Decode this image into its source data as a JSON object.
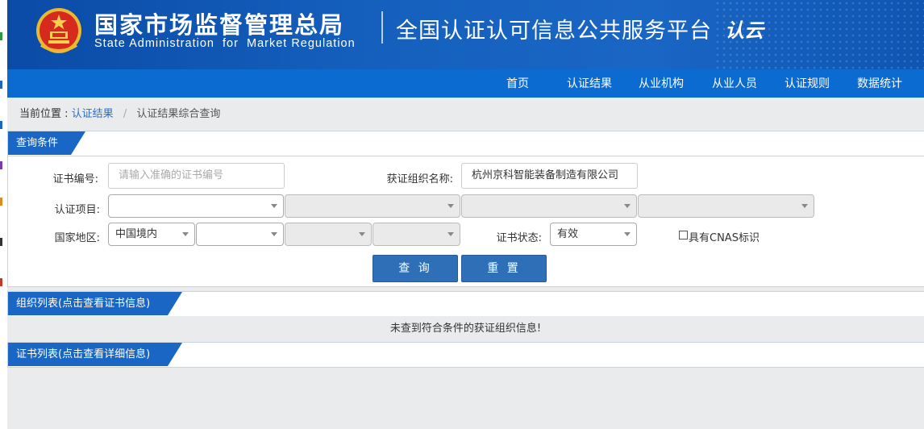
{
  "header": {
    "agency_cn": "国家市场监督管理总局",
    "agency_en": "State Administration  for  Market Regulation",
    "platform": "全国认证认可信息公共服务平台",
    "logo_text": "认云"
  },
  "nav": {
    "items": [
      "首页",
      "认证结果",
      "从业机构",
      "从业人员",
      "认证规则",
      "数据统计"
    ]
  },
  "breadcrumb": {
    "prefix": "当前位置 :",
    "link": "认证结果",
    "separator": "/",
    "current": "认证结果综合查询"
  },
  "query": {
    "title": "查询条件",
    "cert_no_label": "证书编号:",
    "cert_no_placeholder": "请输入准确的证书编号",
    "org_name_label": "获证组织名称:",
    "org_name_value": "杭州京科智能装备制造有限公司",
    "project_label": "认证项目:",
    "region_label": "国家地区:",
    "region_value": "中国境内",
    "status_label": "证书状态:",
    "status_value": "有效",
    "cnas_label": "具有CNAS标识",
    "search_button": "查 询",
    "reset_button": "重 置"
  },
  "org_list": {
    "title": "组织列表(点击查看证书信息)",
    "empty_message": "未查到符合条件的获证组织信息!"
  },
  "cert_list": {
    "title": "证书列表(点击查看详细信息)"
  },
  "colors": {
    "header_blue": "#1560bd",
    "nav_blue": "#0b6bd1",
    "button_blue": "#2f6fb8"
  }
}
